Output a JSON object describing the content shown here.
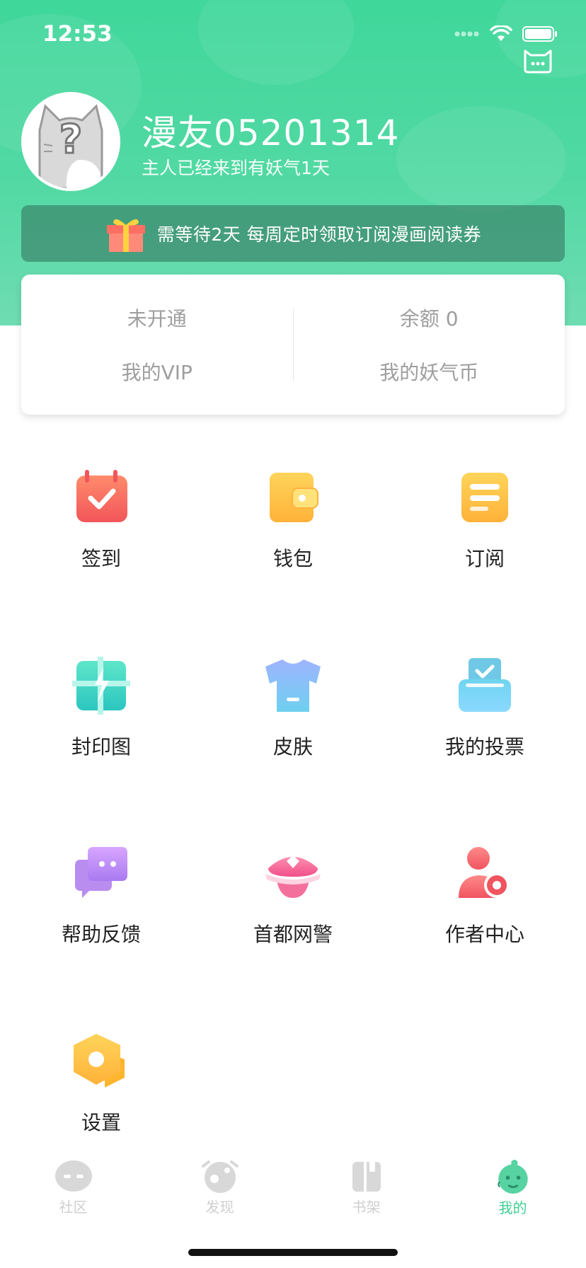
{
  "status_bar": {
    "time": "12:53"
  },
  "profile": {
    "username": "漫友05201314",
    "subtitle": "主人已经来到有妖气1天"
  },
  "notice": {
    "text": "需等待2天  每周定时领取订阅漫画阅读券"
  },
  "wallet": {
    "vip": {
      "value": "未开通",
      "label": "我的VIP"
    },
    "coins": {
      "value": "余额 0",
      "label": "我的妖气币"
    }
  },
  "menu": [
    {
      "label": "签到",
      "icon": "checkin-calendar-icon"
    },
    {
      "label": "钱包",
      "icon": "wallet-icon"
    },
    {
      "label": "订阅",
      "icon": "subscribe-icon"
    },
    {
      "label": "封印图",
      "icon": "seal-image-icon"
    },
    {
      "label": "皮肤",
      "icon": "skin-shirt-icon"
    },
    {
      "label": "我的投票",
      "icon": "vote-box-icon"
    },
    {
      "label": "帮助反馈",
      "icon": "help-feedback-icon"
    },
    {
      "label": "首都网警",
      "icon": "police-cap-icon"
    },
    {
      "label": "作者中心",
      "icon": "author-center-icon"
    },
    {
      "label": "设置",
      "icon": "settings-icon"
    }
  ],
  "tabbar": [
    {
      "label": "社区",
      "active": false
    },
    {
      "label": "发现",
      "active": false
    },
    {
      "label": "书架",
      "active": false
    },
    {
      "label": "我的",
      "active": true
    }
  ],
  "colors": {
    "brand_green": "#3fd79a",
    "active_tab": "#3fcf93"
  }
}
